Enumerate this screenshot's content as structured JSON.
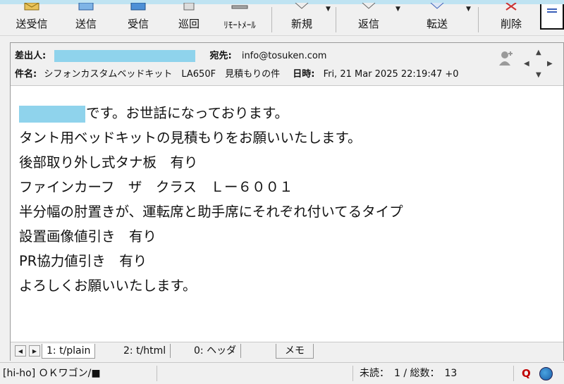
{
  "toolbar": {
    "buttons": [
      {
        "label": "送受信"
      },
      {
        "label": "送信"
      },
      {
        "label": "受信"
      },
      {
        "label": "巡回"
      },
      {
        "label": "ﾘﾓｰﾄﾒｰﾙ"
      },
      {
        "label": "新規"
      },
      {
        "label": "返信"
      },
      {
        "label": "転送"
      },
      {
        "label": "削除"
      }
    ]
  },
  "header": {
    "from_key": "差出人:",
    "to_key": "宛先:",
    "to_value": "info@tosuken.com",
    "subject_key": "件名:",
    "subject_value": "シフォンカスタムベッドキット　LA650F　見積もりの件",
    "date_key": "日時:",
    "date_value": "Fri, 21 Mar 2025 22:19:47 +0"
  },
  "body": {
    "line1_suffix": "です。お世話になっております。",
    "lines": [
      "タント用ベッドキットの見積もりをお願いいたします。",
      "後部取り外し式タナ板　有り",
      "ファインカーフ　ザ　クラス　Ｌー６００１",
      "半分幅の肘置きが、運転席と助手席にそれぞれ付いてるタイプ",
      "設置画像値引き　有り",
      "PR協力値引き　有り",
      "よろしくお願いいたします。"
    ]
  },
  "tabs": {
    "plain": "1: t/plain",
    "html": "2: t/html",
    "header": "0: ヘッダ",
    "memo": "メモ"
  },
  "status": {
    "account": "[hi-ho] ＯＫワゴン/■",
    "unread": "未読：　1 / 総数：　13",
    "q_label": "Q"
  }
}
